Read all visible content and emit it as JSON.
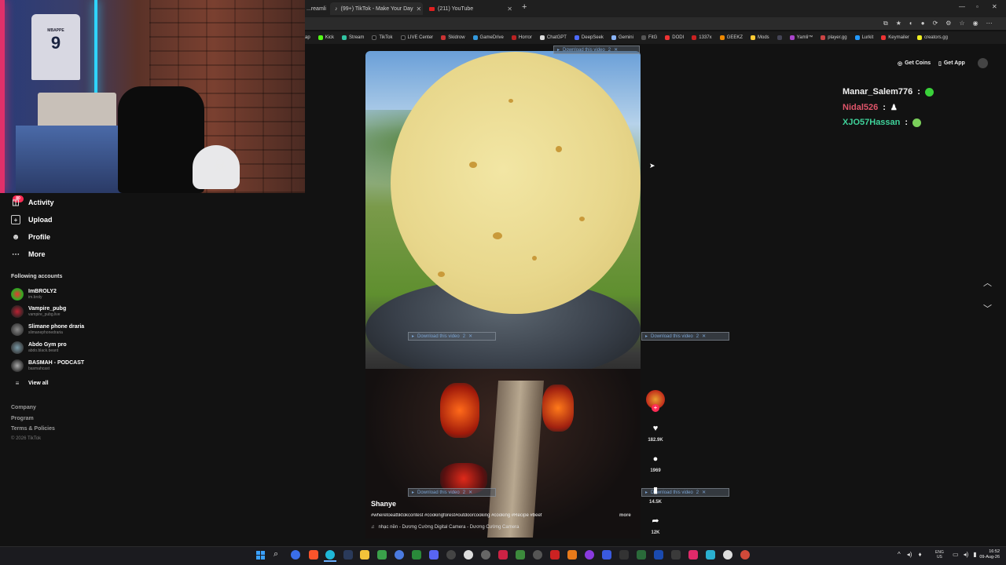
{
  "tabs": [
    {
      "title": "...reamli",
      "active": false
    },
    {
      "title": "(99+) TikTok - Make Your Day",
      "active": true
    },
    {
      "title": "(211) YouTube",
      "active": false
    }
  ],
  "bookmarks": [
    "ap",
    "Kick",
    "Stream",
    "TikTok",
    "LIVE Center",
    "Skidrow",
    "GameDrive",
    "Horror",
    "ChatGPT",
    "DeepSeek",
    "Gemini",
    "FitG",
    "DODI",
    "1337x",
    "GEEKZ",
    "Mods",
    "Yamli™",
    "player.gg",
    "Lurkit",
    "Keymailer",
    "creators.gg"
  ],
  "webcam": {
    "jersey_name": "MBAPPE",
    "jersey_number": "9"
  },
  "sidebar": {
    "badge": "80",
    "items": [
      {
        "label": "Activity",
        "icon": "activity-icon"
      },
      {
        "label": "Upload",
        "icon": "upload-icon"
      },
      {
        "label": "Profile",
        "icon": "profile-icon"
      },
      {
        "label": "More",
        "icon": "more-icon"
      }
    ],
    "following_title": "Following accounts",
    "accounts": [
      {
        "name": "ImBROLY2",
        "handle": "im.broly"
      },
      {
        "name": "Vampire_pubg",
        "handle": "vampire_pubg.live"
      },
      {
        "name": "Slimane phone draria",
        "handle": "slimanephonedraria"
      },
      {
        "name": "Abdo Gym pro",
        "handle": "abdo.black.beard"
      },
      {
        "name": "BASMAH - PODCAST",
        "handle": "basmahcast"
      }
    ],
    "view_all": "View all",
    "footer": [
      "Company",
      "Program",
      "Terms & Policies"
    ],
    "copyright": "© 2026 TikTok"
  },
  "header_buttons": {
    "coins": "Get Coins",
    "app": "Get App"
  },
  "video": {
    "author": "Shanye",
    "caption": "#wheretoeattiktokcontest #cookingforest#outdoorcooking #cooking #Recipe #beef",
    "more": "more",
    "music": "nhạc nền - Dương Cường Digital Camera - Dương Cường Camera",
    "download_label": "Download this video",
    "download_count": "2"
  },
  "actions": {
    "likes": "182.9K",
    "comments": "1969",
    "saves": "14.5K",
    "shares": "12K"
  },
  "chat": [
    {
      "user": "Manar_Salem776",
      "color": "#f0f0f0"
    },
    {
      "user": "Nidal526",
      "color": "#e0556a"
    },
    {
      "user": "XJO57Hassan",
      "color": "#3fd29a"
    }
  ],
  "system_tray": {
    "lang": "ENG",
    "region": "US",
    "time": "16:52",
    "date": "09-Aug-26"
  }
}
